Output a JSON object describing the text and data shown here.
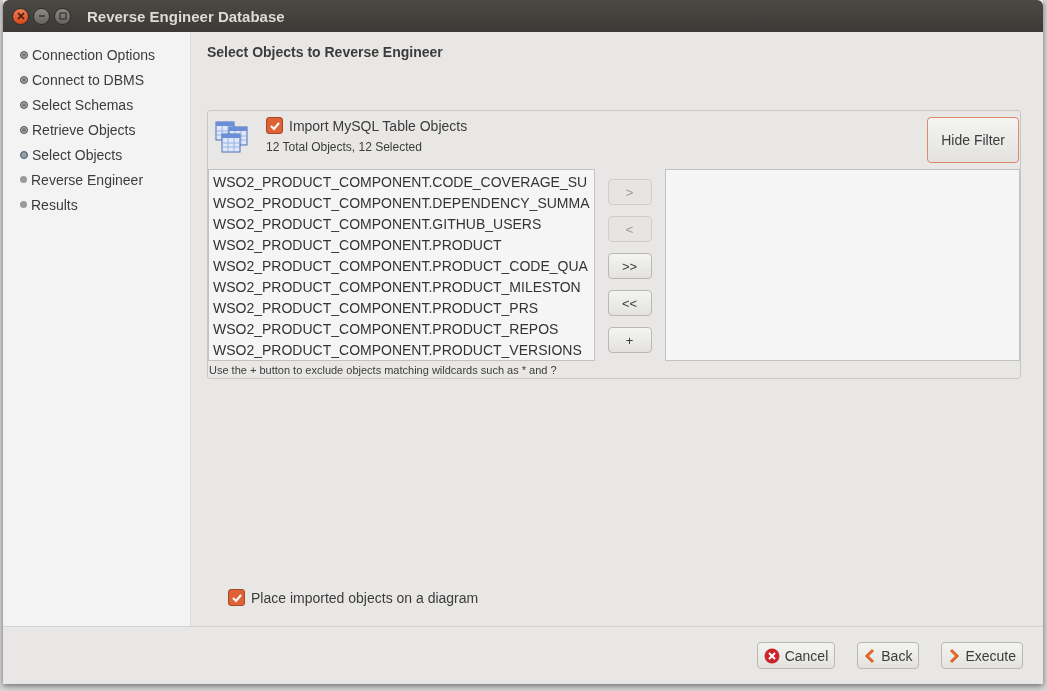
{
  "window": {
    "title": "Reverse Engineer Database"
  },
  "steps": [
    {
      "label": "Connection Options",
      "done": true,
      "selected": false
    },
    {
      "label": "Connect to DBMS",
      "done": true,
      "selected": false
    },
    {
      "label": "Select Schemas",
      "done": true,
      "selected": false
    },
    {
      "label": "Retrieve Objects",
      "done": true,
      "selected": false
    },
    {
      "label": "Select Objects",
      "done": false,
      "selected": true
    },
    {
      "label": "Reverse Engineer",
      "done": false,
      "selected": false
    },
    {
      "label": "Results",
      "done": false,
      "selected": false
    }
  ],
  "page_title": "Select Objects to Reverse Engineer",
  "filter": {
    "import_label": "Import MySQL Table Objects",
    "import_checked": true,
    "summary": "12 Total Objects, 12 Selected",
    "hide_button": "Hide Filter",
    "objects": [
      "WSO2_PRODUCT_COMPONENT.CODE_COVERAGE_SU",
      "WSO2_PRODUCT_COMPONENT.DEPENDENCY_SUMMA",
      "WSO2_PRODUCT_COMPONENT.GITHUB_USERS",
      "WSO2_PRODUCT_COMPONENT.PRODUCT",
      "WSO2_PRODUCT_COMPONENT.PRODUCT_CODE_QUA",
      "WSO2_PRODUCT_COMPONENT.PRODUCT_MILESTON",
      "WSO2_PRODUCT_COMPONENT.PRODUCT_PRS",
      "WSO2_PRODUCT_COMPONENT.PRODUCT_REPOS",
      "WSO2_PRODUCT_COMPONENT.PRODUCT_VERSIONS"
    ],
    "move_buttons": [
      {
        "label": ">",
        "disabled": true
      },
      {
        "label": "<",
        "disabled": true
      },
      {
        "label": ">>",
        "disabled": false
      },
      {
        "label": "<<",
        "disabled": false
      },
      {
        "label": "+",
        "disabled": false
      }
    ],
    "hint": "Use the + button to exclude objects matching wildcards such as * and ?"
  },
  "place_on_diagram": {
    "label": "Place imported objects on a diagram",
    "checked": true
  },
  "buttons": [
    {
      "label": "Cancel",
      "kind": "cancel"
    },
    {
      "label": "Back",
      "kind": "back"
    },
    {
      "label": "Execute",
      "kind": "next"
    }
  ]
}
